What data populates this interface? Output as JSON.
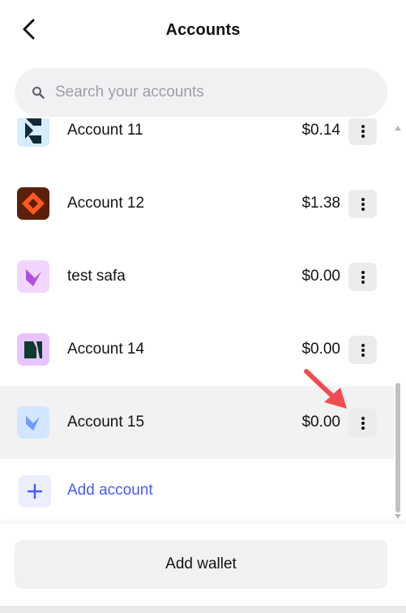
{
  "header": {
    "title": "Accounts",
    "back_icon": "chevron-left-icon"
  },
  "search": {
    "placeholder": "Search your accounts",
    "value": "",
    "icon": "search-icon"
  },
  "accounts": [
    {
      "name": "Account 11",
      "balance": "$0.14",
      "avatar_colors": [
        "#d6ecff",
        "#0e2b37"
      ]
    },
    {
      "name": "Account 12",
      "balance": "$1.38",
      "avatar_colors": [
        "#5c1f0a",
        "#ff5a1f"
      ]
    },
    {
      "name": "test safa",
      "balance": "$0.00",
      "avatar_colors": [
        "#f1d6ff",
        "#b34dde"
      ]
    },
    {
      "name": "Account 14",
      "balance": "$0.00",
      "avatar_colors": [
        "#e8c4ff",
        "#0f3a2e"
      ]
    },
    {
      "name": "Account 15",
      "balance": "$0.00",
      "avatar_colors": [
        "#d3e6ff",
        "#6c9dff"
      ],
      "selected": true
    }
  ],
  "add_account": {
    "label": "Add account",
    "icon": "plus-icon",
    "color": "#4459ff"
  },
  "footer": {
    "add_wallet_label": "Add wallet"
  },
  "annotation": {
    "icon": "red-arrow-pointer-icon",
    "color": "#f14b52"
  }
}
